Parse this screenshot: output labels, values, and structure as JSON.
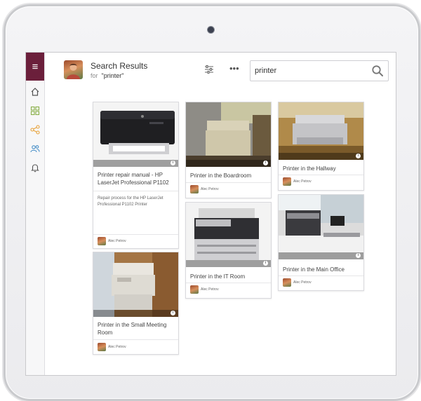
{
  "header": {
    "title": "Search Results",
    "for_label": "for",
    "query_display": "\"printer\""
  },
  "search": {
    "value": "printer"
  },
  "toolbar": {
    "more_label": "•••"
  },
  "rail": {
    "menu_glyph": "≡"
  },
  "icons": [
    "menu-icon",
    "home-icon",
    "grid-icon",
    "share-icon",
    "users-icon",
    "bell-icon",
    "filter-icon",
    "search-icon",
    "info-icon"
  ],
  "colors": {
    "accent": "#6b1f3b",
    "rail_icon_home": "#555555",
    "rail_icon_grid": "#8ab04a",
    "rail_icon_share": "#e8a23a",
    "rail_icon_users": "#4a90c8",
    "rail_icon_bell": "#555555"
  },
  "cards": [
    {
      "title": "Printer repair manual - HP LaserJet Professional P1102",
      "description": "Repair process for the HP LaserJet Professional P1102 Printer",
      "author": "Alec Petrov"
    },
    {
      "title": "Printer in the Small Meeting Room",
      "author": "Alec Petrov"
    },
    {
      "title": "Printer in the Boardroom",
      "author": "Alec Petrov"
    },
    {
      "title": "Printer in the IT Room",
      "author": "Alec Petrov"
    },
    {
      "title": "Printer in the Hallway",
      "author": "Alec Petrov"
    },
    {
      "title": "Printer in the Main Office",
      "author": "Alec Petrov"
    }
  ]
}
